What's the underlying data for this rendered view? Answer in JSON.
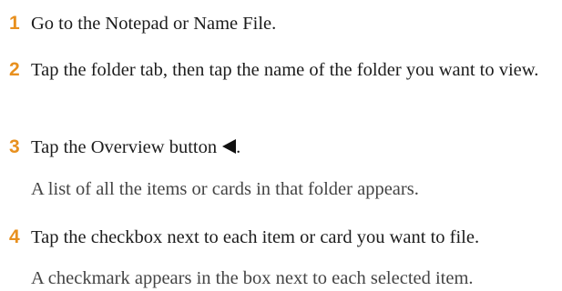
{
  "steps": [
    {
      "number": "1",
      "text": "Go to the Notepad or Name File."
    },
    {
      "number": "2",
      "text": "Tap the folder tab, then tap the name of the folder you want to view."
    },
    {
      "number": "3",
      "text": "Tap the Overview button",
      "text_end": ".",
      "icon": "overview-triangle-left-icon",
      "note": "A list of all the items or cards in that folder appears."
    },
    {
      "number": "4",
      "text": "Tap the checkbox next to each item or card you want to file.",
      "note": "A checkmark appears in the box next to each selected item."
    }
  ],
  "accent_color": "#e8901e"
}
